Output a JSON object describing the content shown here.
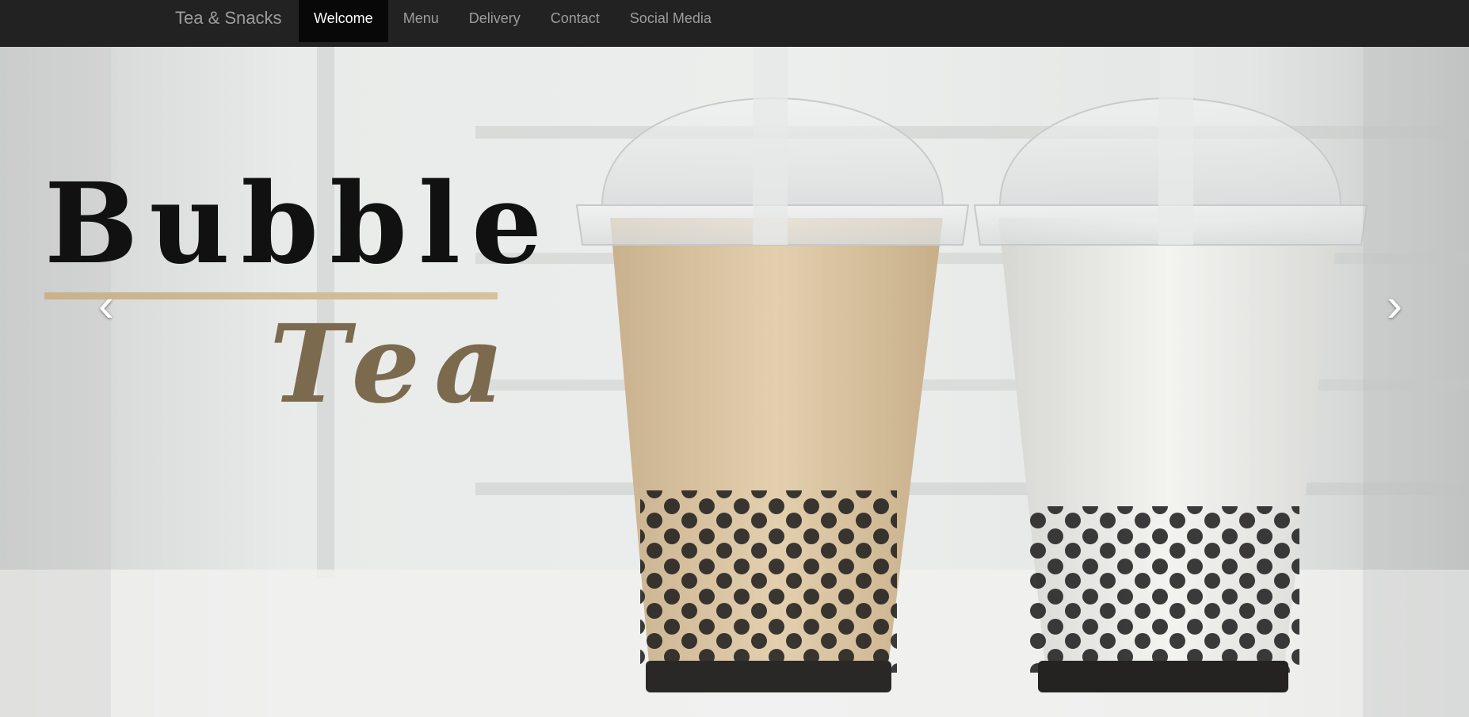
{
  "navbar": {
    "brand": "Tea & Snacks",
    "links": [
      {
        "label": "Welcome",
        "active": true
      },
      {
        "label": "Menu",
        "active": false
      },
      {
        "label": "Delivery",
        "active": false
      },
      {
        "label": "Contact",
        "active": false
      },
      {
        "label": "Social Media",
        "active": false
      }
    ]
  },
  "carousel": {
    "slide_logo": {
      "line1": "Bubble",
      "line2": "Tea"
    },
    "prev_icon": "chevron-left-icon",
    "next_icon": "chevron-right-icon",
    "prev_glyph": "‹",
    "next_glyph": "›",
    "slide_count": 3,
    "active_slide": 2
  },
  "colors": {
    "navbar_bg": "#222222",
    "nav_active_bg": "#080808",
    "nav_text": "#9d9d9d",
    "logo_dark": "#111111",
    "logo_accent": "#7c6a4f",
    "logo_bar": "#c9b28a"
  }
}
